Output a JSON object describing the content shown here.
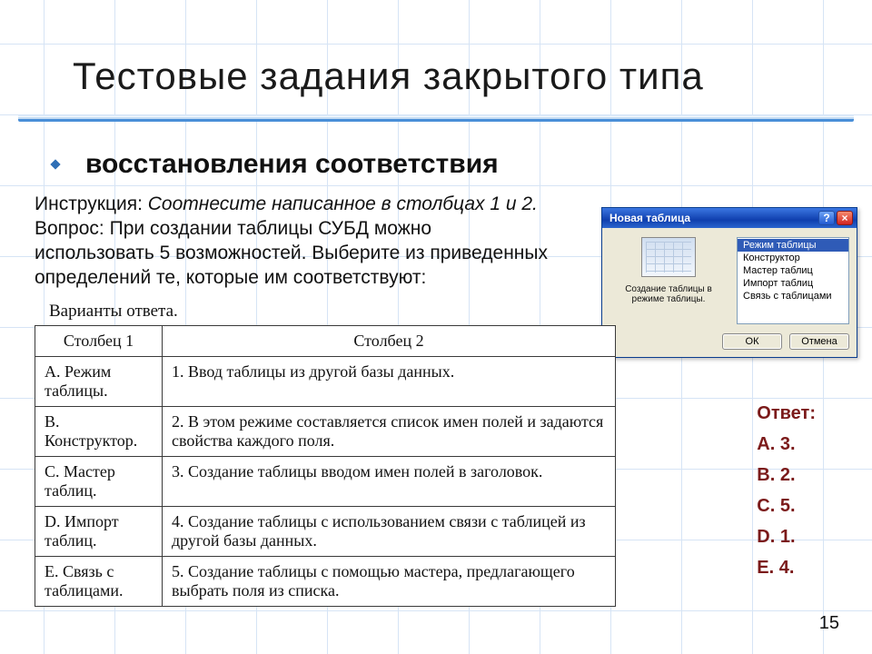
{
  "title": "Тестовые задания закрытого типа",
  "subtitle": "восстановления соответствия",
  "instruction_label": "Инструкция:",
  "instruction_text": "Соотнесите написанное в столбцах 1 и 2.",
  "question_label": "Вопрос:",
  "question_text": "При создании таблицы СУБД можно использовать 5 возможностей. Выберите из приведенных определений те, которые им соответствуют:",
  "answers_caption": "Варианты ответа.",
  "table": {
    "col1_header": "Столбец 1",
    "col2_header": "Столбец 2",
    "rows": [
      {
        "c1": "A. Режим таблицы.",
        "c2": "1. Ввод таблицы из другой базы данных."
      },
      {
        "c1": "B. Конструктор.",
        "c2": "2. В этом режиме составляется список имен полей и задаются свойства каждого поля."
      },
      {
        "c1": "C. Мастер таблиц.",
        "c2": "3. Создание таблицы вводом имен полей в заголовок."
      },
      {
        "c1": "D. Импорт таблиц.",
        "c2": "4. Создание таблицы с использованием связи с таблицей из другой базы данных."
      },
      {
        "c1": "E. Связь с таблицами.",
        "c2": "5. Создание таблицы с помощью мастера, предлагающего выбрать поля из списка."
      }
    ]
  },
  "dialog": {
    "title": "Новая таблица",
    "caption": "Создание таблицы в режиме таблицы.",
    "options": [
      "Режим таблицы",
      "Конструктор",
      "Мастер таблиц",
      "Импорт таблиц",
      "Связь с таблицами"
    ],
    "ok": "ОК",
    "cancel": "Отмена"
  },
  "answer": {
    "label": "Ответ:",
    "lines": [
      "A. 3.",
      "B. 2.",
      "C. 5.",
      "D. 1.",
      "E. 4."
    ]
  },
  "slide_number": "15"
}
